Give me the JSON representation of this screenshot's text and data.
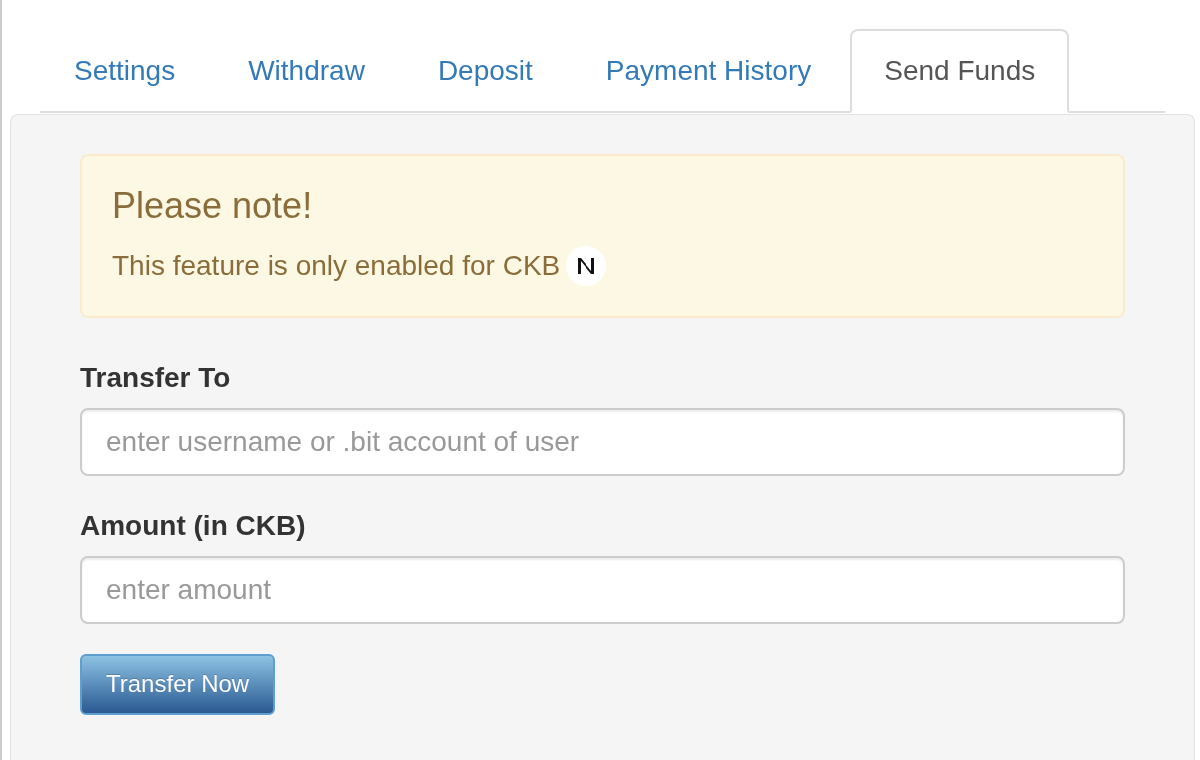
{
  "tabs": [
    {
      "label": "Settings",
      "selected": false
    },
    {
      "label": "Withdraw",
      "selected": false
    },
    {
      "label": "Deposit",
      "selected": false
    },
    {
      "label": "Payment History",
      "selected": false
    },
    {
      "label": "Send Funds",
      "selected": true
    }
  ],
  "notice": {
    "title": "Please note!",
    "text": "This feature is only enabled for CKB"
  },
  "form": {
    "fields": [
      {
        "label": "Transfer To",
        "placeholder": "enter username or .bit account of user"
      },
      {
        "label": "Amount (in CKB)",
        "placeholder": "enter amount"
      }
    ],
    "submit": "Transfer Now"
  }
}
